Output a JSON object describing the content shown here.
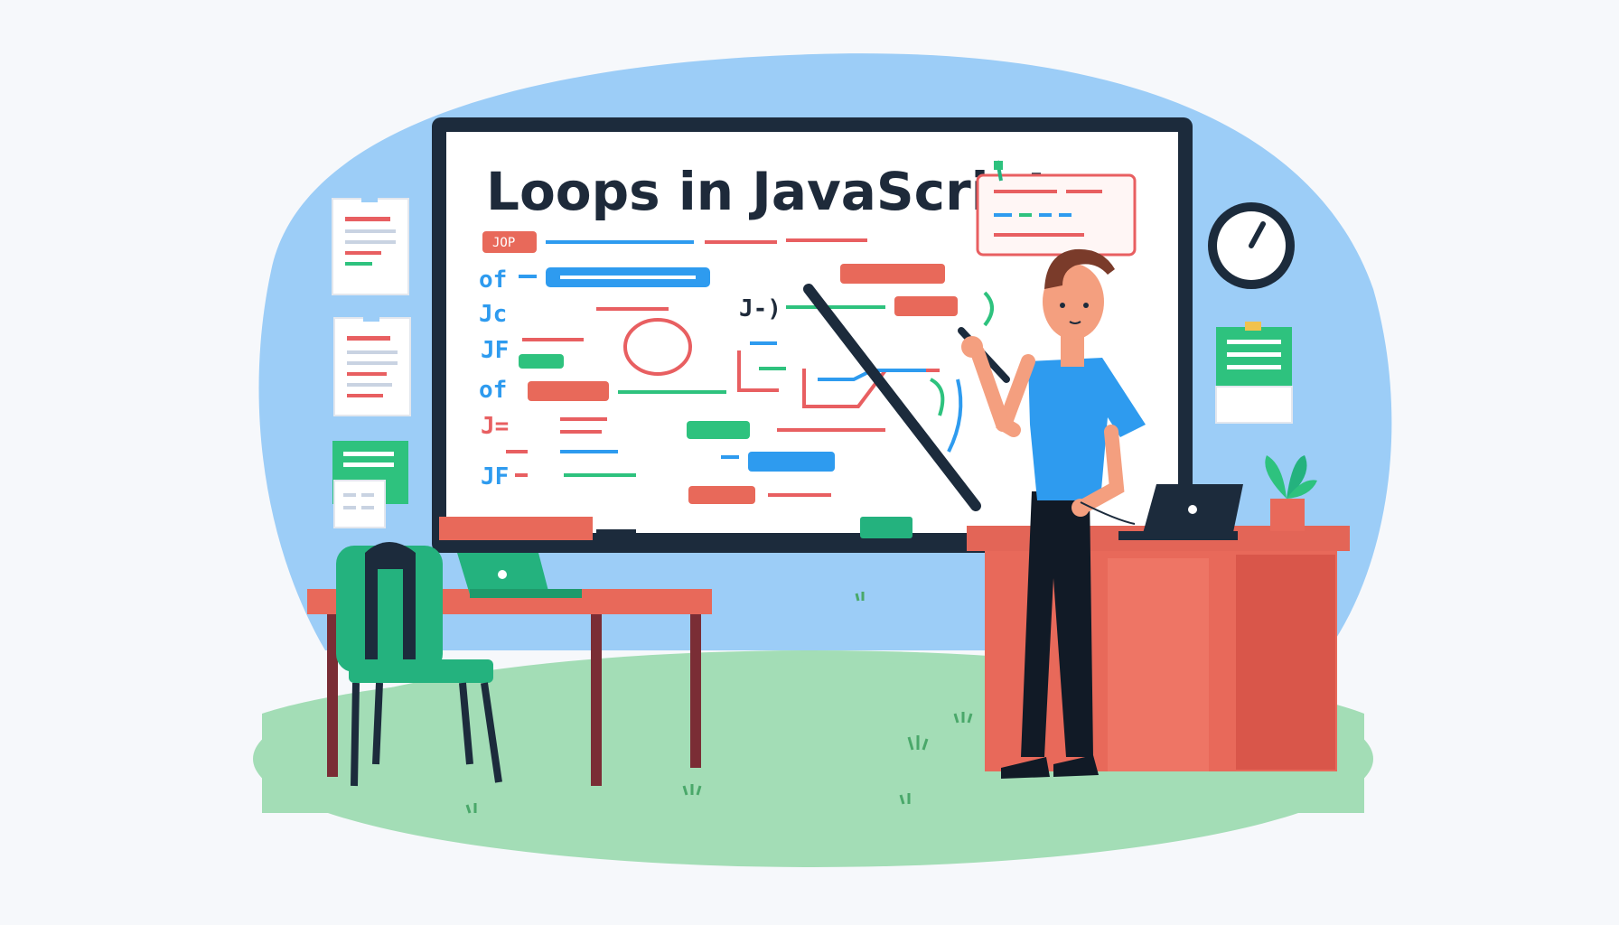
{
  "whiteboard": {
    "title": "Loops in JavaScript",
    "code_labels": [
      "JOP",
      "of",
      "Jc",
      "JF",
      "of",
      "J=",
      "JF",
      "J-)"
    ]
  },
  "colors": {
    "background_blob": "#9ccdf7",
    "grass": "#9fdcb3",
    "board_frame": "#1c2b3c",
    "desk": "#e8695a",
    "chair": "#24b27e",
    "shirt": "#2e9bef",
    "code_red": "#e85f61",
    "code_blue": "#2e9bef",
    "code_green": "#2ec27e"
  },
  "icons": [
    "clock-icon",
    "laptop-icon",
    "plant-icon",
    "pointer-stick",
    "notes-icon"
  ]
}
